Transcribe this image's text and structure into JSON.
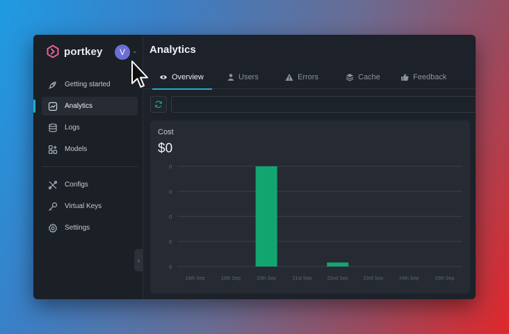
{
  "sidebar": {
    "brand": "portkey",
    "avatar_initial": "V",
    "nav_main": [
      {
        "label": "Getting started",
        "icon": "rocket-icon"
      },
      {
        "label": "Analytics",
        "icon": "chart-line-icon",
        "active": true
      },
      {
        "label": "Logs",
        "icon": "database-icon"
      },
      {
        "label": "Models",
        "icon": "grid-plus-icon"
      }
    ],
    "nav_secondary": [
      {
        "label": "Configs",
        "icon": "tools-icon"
      },
      {
        "label": "Virtual Keys",
        "icon": "key-icon"
      },
      {
        "label": "Settings",
        "icon": "gear-icon"
      }
    ]
  },
  "header": {
    "title": "Analytics"
  },
  "tabs": [
    {
      "label": "Overview",
      "icon": "eye-icon",
      "active": true
    },
    {
      "label": "Users",
      "icon": "user-icon"
    },
    {
      "label": "Errors",
      "icon": "warning-icon"
    },
    {
      "label": "Cache",
      "icon": "layers-icon"
    },
    {
      "label": "Feedback",
      "icon": "thumbs-up-icon"
    }
  ],
  "card": {
    "title": "Cost",
    "value": "$0"
  },
  "colors": {
    "accent": "#21b0c7",
    "bar": "#13a570",
    "brand": "#e2639a"
  },
  "chart_data": {
    "type": "bar",
    "title": "Cost",
    "categories": [
      "18th Sep",
      "19th Sep",
      "20th Sep",
      "21st Sep",
      "22nd Sep",
      "23rd Sep",
      "24th Sep",
      "25th Sep"
    ],
    "series": [
      {
        "values": [
          0,
          0,
          1.0,
          0,
          0.04,
          0,
          0,
          0
        ]
      }
    ],
    "y_tick_labels": [
      "0",
      "0",
      "0",
      "0",
      "0"
    ],
    "ylim": [
      0,
      1.0
    ],
    "grid": true,
    "xlabel": "",
    "ylabel": ""
  }
}
